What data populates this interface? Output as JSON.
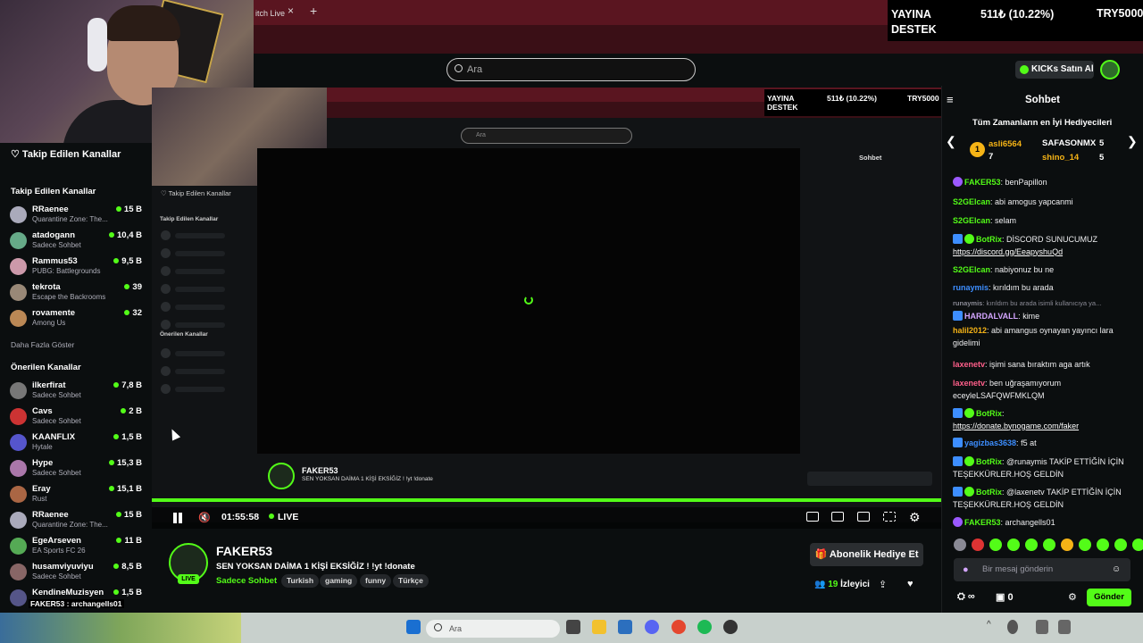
{
  "browser": {
    "tab_title": "itch Live ",
    "tab_close": "×",
    "new_tab": "+"
  },
  "overlay": {
    "label_line1": "YAYINA",
    "label_line2": "DESTEK",
    "amount": "511₺ (10.22%)",
    "goal": "TRY5000"
  },
  "header": {
    "search_placeholder": "Ara",
    "kicks_button": "KICKs Satın Al"
  },
  "sidebar": {
    "header": "Takip Edilen Kanallar",
    "following_title": "Takip Edilen Kanallar",
    "following": [
      {
        "name": "RRaenee",
        "category": "Quarantine Zone: The...",
        "viewers": "15 B",
        "color": "#aab"
      },
      {
        "name": "atadogann",
        "category": "Sadece Sohbet",
        "viewers": "10,4 B",
        "color": "#6a8"
      },
      {
        "name": "Rammus53",
        "category": "PUBG: Battlegrounds",
        "viewers": "9,5 B",
        "color": "#c9a"
      },
      {
        "name": "tekrota",
        "category": "Escape the Backrooms",
        "viewers": "39",
        "color": "#987"
      },
      {
        "name": "rovamente",
        "category": "Among Us",
        "viewers": "32",
        "color": "#b85"
      }
    ],
    "show_more": "Daha Fazla Göster",
    "recommended_title": "Önerilen Kanallar",
    "recommended": [
      {
        "name": "ilkerfirat",
        "category": "Sadece Sohbet",
        "viewers": "7,8 B",
        "color": "#777"
      },
      {
        "name": "Cavs",
        "category": "Sadece Sohbet",
        "viewers": "2 B",
        "color": "#c33"
      },
      {
        "name": "KAANFLIX",
        "category": "Hytale",
        "viewers": "1,5 B",
        "color": "#55c"
      },
      {
        "name": "Hype",
        "category": "Sadece Sohbet",
        "viewers": "15,3 B",
        "color": "#a7a"
      },
      {
        "name": "Eray",
        "category": "Rust",
        "viewers": "15,1 B",
        "color": "#a64"
      },
      {
        "name": "RRaenee",
        "category": "Quarantine Zone: The...",
        "viewers": "15 B",
        "color": "#aab"
      },
      {
        "name": "EgeArseven",
        "category": "EA Sports FC 26",
        "viewers": "11 B",
        "color": "#5a5"
      },
      {
        "name": "husamviyuviyu",
        "category": "Sadece Sohbet",
        "viewers": "8,5 B",
        "color": "#866"
      },
      {
        "name": "KendineMuzisyen",
        "category": "",
        "viewers": "1,5 B",
        "color": "#558"
      }
    ]
  },
  "nested": {
    "overlay_l1": "YAYINA",
    "overlay_l2": "DESTEK",
    "overlay_amount": "511₺ (10.22%)",
    "overlay_goal": "TRY5000",
    "search": "Ara",
    "sidebar_title": "Takip Edilen Kanallar",
    "following": "Takip Edilen Kanallar",
    "recommended": "Önerilen Kanallar",
    "chat_title": "Sohbet",
    "streamer": "FAKER53",
    "title": "SEN YOKSAN DAİMA 1 KİŞİ EKSİĞİZ ! !yt !donate"
  },
  "player": {
    "time": "01:55:58",
    "live": "LIVE"
  },
  "stream": {
    "streamer": "FAKER53",
    "live_badge": "LIVE",
    "title": "SEN YOKSAN DAİMA 1 KİŞİ EKSİĞİZ !  !yt !donate",
    "category": "Sadece Sohbet",
    "tags": [
      "Turkish",
      "gaming",
      "funny",
      "Türkçe"
    ],
    "sub_gift": "Abonelik Hediye Et",
    "viewers": "19",
    "viewers_label": "İzleyici"
  },
  "chat": {
    "title": "Sohbet",
    "gifters_title": "Tüm Zamanların en İyi Hediyecileri",
    "gifters": [
      {
        "name": "asli6564",
        "count": "7"
      },
      {
        "name": "SAFASONMX",
        "count": "5"
      },
      {
        "name": "shino_14",
        "count": "5"
      }
    ],
    "input_placeholder": "Bir mesaj gönderin",
    "points": "∞",
    "counter": "0",
    "send": "Gönder",
    "messages": [
      {
        "user": "FAKER53",
        "text": "benPapillon",
        "color": "#53fc18"
      },
      {
        "user": "S2GElcan",
        "text": "abi amogus yapcanmi",
        "color": "#53fc18"
      },
      {
        "user": "S2GElcan",
        "text": "selam",
        "color": "#53fc18"
      },
      {
        "user": "BotRix",
        "text": "DİSCORD SUNUCUMUZ",
        "link": "https://discord.gg/EeapyshuQd",
        "color": "#53fc18"
      },
      {
        "user": "S2GElcan",
        "text": "nabiyonuz bu ne",
        "color": "#53fc18"
      },
      {
        "user": "runaymis",
        "text": "kırıldım bu arada",
        "color": "#3d8eff"
      },
      {
        "user": "runaymis",
        "text": "kırıldım bu arada isimli kullanıcıya ya...",
        "color": "#8a8a95"
      },
      {
        "user": "HARDALVALL",
        "text": "kime",
        "color": "#d4a6ff"
      },
      {
        "user": "halil2012",
        "text": "abi amangus oynayan yayıncı lara gidelimi",
        "color": "#f5b316"
      },
      {
        "user": "laxenetv",
        "text": "işimi sana bıraktım aga artık",
        "color": "#ff5f8a"
      },
      {
        "user": "laxenetv",
        "text": "ben uğraşamıyorum eceyleLSAFQWFMKLQM",
        "color": "#ff5f8a"
      },
      {
        "user": "BotRix",
        "text": "",
        "link": "https://donate.bynogame.com/faker",
        "color": "#53fc18"
      },
      {
        "user": "yagizbas3638",
        "text": "f5 at",
        "color": "#3d8eff"
      },
      {
        "user": "BotRix",
        "text": "@runaymis TAKİP ETTİĞİN İÇİN TEŞEKKÜRLER.HOŞ GELDİN",
        "color": "#53fc18"
      },
      {
        "user": "BotRix",
        "text": "@laxenetv TAKİP ETTİĞİN İÇİN TEŞEKKÜRLER.HOŞ GELDİN",
        "color": "#53fc18"
      },
      {
        "user": "FAKER53",
        "text": "archangells01",
        "color": "#53fc18"
      }
    ]
  },
  "hover_label": "FAKER53 : archangells01",
  "taskbar": {
    "search": "Ara"
  },
  "colors": {
    "accent": "#53fc18",
    "background": "#0b0e0f",
    "browser_frame": "#3a0f16"
  }
}
